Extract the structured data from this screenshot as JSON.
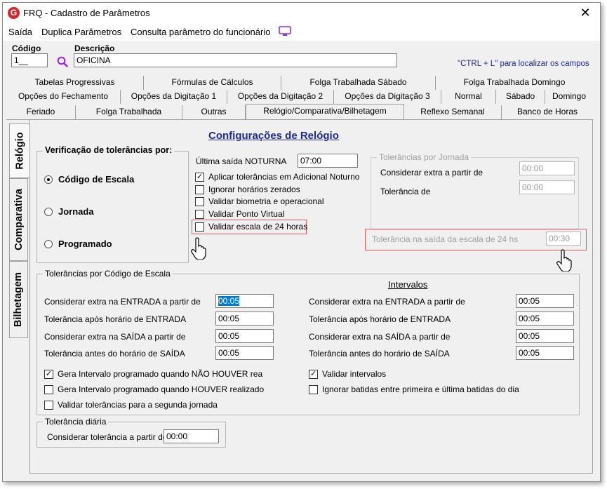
{
  "window": {
    "title": "FRQ - Cadastro de Parâmetros",
    "logo_letter": "G",
    "close_symbol": "✕"
  },
  "menu": [
    "Saída",
    "Duplica Parâmetros",
    "Consulta parâmetro do funcionário"
  ],
  "header": {
    "codigo_label": "Código",
    "codigo_value": "1__",
    "descricao_label": "Descrição",
    "descricao_value": "OFICINA",
    "hint": "\"CTRL + L\" para localizar os campos"
  },
  "tabs": {
    "row1": [
      "Tabelas Progressivas",
      "Fórmulas de Cálculos",
      "Folga Trabalhada Sábado",
      "Folga Trabalhada Domingo"
    ],
    "row2": [
      "Opções do Fechamento",
      "Opções da Digitação 1",
      "Opções da Digitação 2",
      "Opções da Digitação 3",
      "Normal",
      "Sábado",
      "Domingo"
    ],
    "row3": [
      "Feriado",
      "Folga Trabalhada",
      "Outras",
      "Relógio/Comparativa/Bilhetagem",
      "Reflexo Semanal",
      "Banco de Horas"
    ]
  },
  "side_tabs": [
    "Relógio",
    "Comparativa",
    "Bilhetagem"
  ],
  "config_title": "Configurações de Relógio",
  "verificacao": {
    "title": "Verificação de tolerâncias por:",
    "options": [
      "Código de Escala",
      "Jornada",
      "Programado"
    ],
    "selected": 0
  },
  "noturna": {
    "label": "Última saída NOTURNA",
    "value": "07:00"
  },
  "checks_top": [
    {
      "label": "Aplicar tolerâncias em Adicional Noturno",
      "checked": true
    },
    {
      "label": "Ignorar horários zerados",
      "checked": false
    },
    {
      "label": "Validar biometria e operacional",
      "checked": false
    },
    {
      "label": "Validar Ponto Virtual",
      "checked": false
    },
    {
      "label": "Validar escala de 24 horas",
      "checked": false
    }
  ],
  "tolerancias_jornada": {
    "title": "Tolerâncias por Jornada",
    "rows": [
      {
        "label": "Considerar extra a partir de",
        "value": "00:00"
      },
      {
        "label": "Tolerância de",
        "value": "00:00"
      }
    ]
  },
  "saida_24hs": {
    "label": "Tolerância na saída da escala de 24 hs",
    "value": "00:30"
  },
  "tolerancias_escala": {
    "title": "Tolerâncias por Código de Escala",
    "rows": [
      {
        "label": "Considerar extra na ENTRADA a partir de",
        "value": "00:05"
      },
      {
        "label": "Tolerância após horário de ENTRADA",
        "value": "00:05"
      },
      {
        "label": "Considerar extra na SAÍDA a partir de",
        "value": "00:05"
      },
      {
        "label": "Tolerância antes do horário de SAÍDA",
        "value": "00:05"
      }
    ]
  },
  "intervalos": {
    "title": "Intervalos",
    "rows": [
      {
        "label": "Considerar extra na ENTRADA a partir de",
        "value": "00:05"
      },
      {
        "label": "Tolerância após horário de ENTRADA",
        "value": "00:05"
      },
      {
        "label": "Considerar extra na SAÍDA a partir de",
        "value": "00:05"
      },
      {
        "label": "Tolerância antes do horário de SAÍDA",
        "value": "00:05"
      }
    ]
  },
  "checks_bottom_left": [
    {
      "label": "Gera Intervalo programado quando NÃO HOUVER rea",
      "checked": true
    },
    {
      "label": "Gera Intervalo programado quando HOUVER realizado",
      "checked": false
    },
    {
      "label": "Validar tolerâncias para a segunda jornada",
      "checked": false
    }
  ],
  "checks_bottom_right": [
    {
      "label": "Validar intervalos",
      "checked": true
    },
    {
      "label": "Ignorar batidas entre primeira e última batidas do dia",
      "checked": false
    }
  ],
  "tolerancia_diaria": {
    "title": "Tolerância diária",
    "label": "Considerar tolerância a partir de",
    "value": "00:00"
  },
  "colors": {
    "accent_title": "#1e2896",
    "highlight": "#e05a5a",
    "selection": "#0078d7",
    "logo": "#d7262b"
  }
}
